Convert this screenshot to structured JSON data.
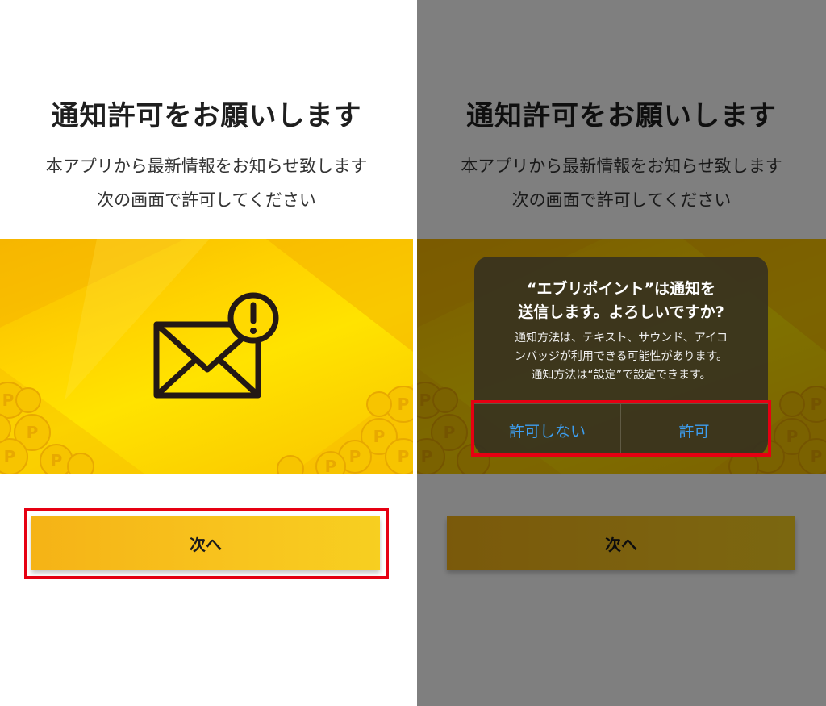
{
  "left": {
    "title": "通知許可をお願いします",
    "description_line1": "本アプリから最新情報をお知らせ致します",
    "description_line2": "次の画面で許可してください",
    "next_label": "次へ"
  },
  "right": {
    "title": "通知許可をお願いします",
    "description_line1": "本アプリから最新情報をお知らせ致します",
    "description_line2": "次の画面で許可してください",
    "next_label": "次へ",
    "alert": {
      "title_line1": "“エブリポイント”は通知を",
      "title_line2": "送信します。よろしいですか?",
      "message_line1": "通知方法は、テキスト、サウンド、アイコ",
      "message_line2": "ンバッジが利用できる可能性があります。",
      "message_line3": "通知方法は“設定”で設定できます。",
      "deny_label": "許可しない",
      "allow_label": "許可"
    }
  },
  "icons": {
    "mail": "envelope-alert-icon",
    "coin": "p-coin-icon"
  },
  "colors": {
    "accent_yellow": "#f8c41e",
    "highlight_red": "#e60012",
    "ios_blue": "#3d9ef0"
  }
}
